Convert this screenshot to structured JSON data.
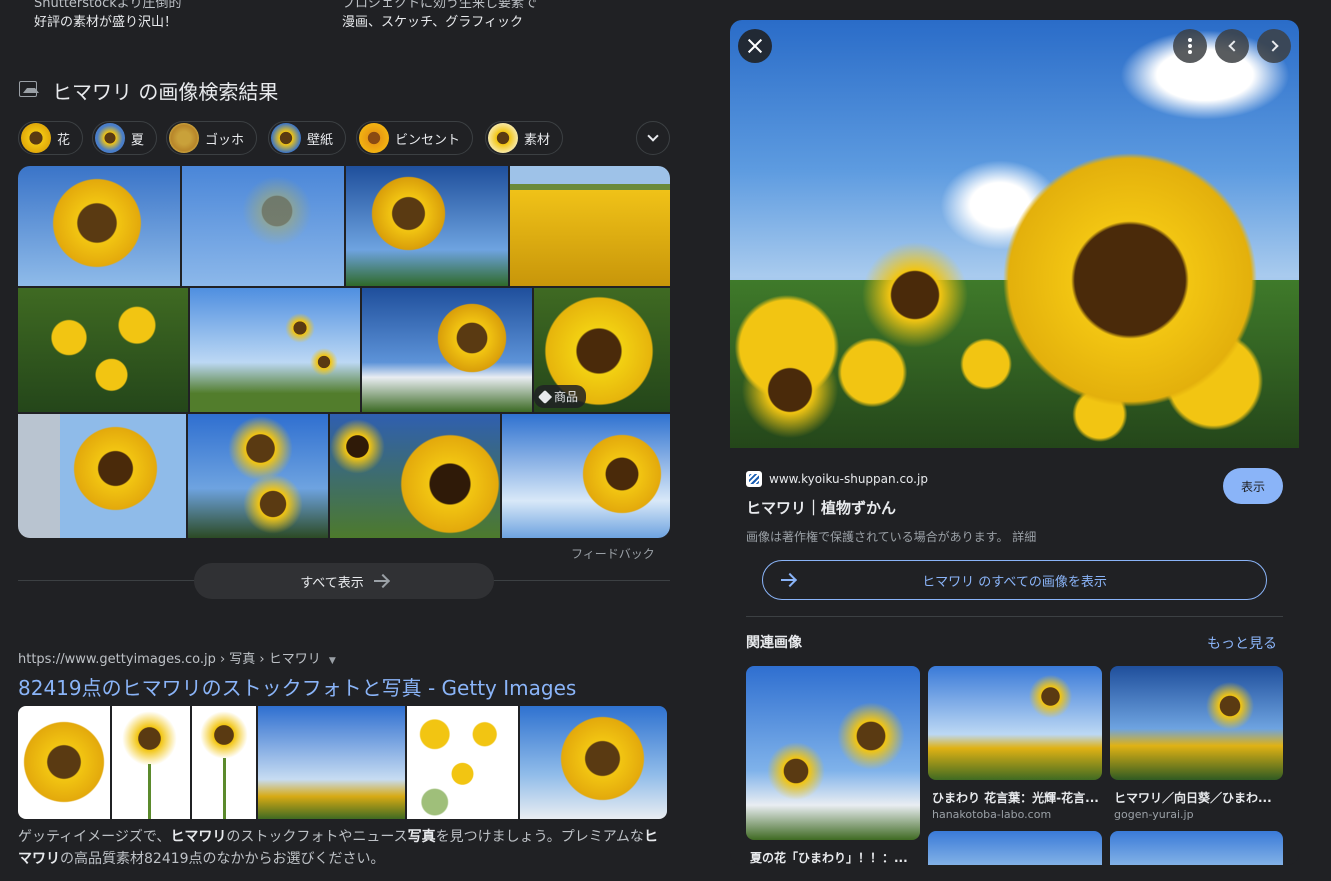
{
  "top_snippets": {
    "left_cut": "Shutterstockより圧倒的",
    "left_line": "好評の素材が盛り沢山！",
    "right_cut": "プロジェクトに効う生来し要素で",
    "right_line": "漫画、スケッチ、グラフィック"
  },
  "images_section": {
    "title": "ヒマワリ の画像検索結果",
    "chips": [
      "花",
      "夏",
      "ゴッホ",
      "壁紙",
      "ビンセント",
      "素材"
    ],
    "product_badge": "商品",
    "feedback": "フィードバック",
    "show_all": "すべて表示"
  },
  "result": {
    "breadcrumb": "https://www.gettyimages.co.jp › 写真 › ヒマワリ",
    "title": "82419点のヒマワリのストックフォトと写真 - Getty Images",
    "snippet_1": "ゲッティイメージズで、",
    "snippet_b1": "ヒマワリ",
    "snippet_2": "のストックフォトやニュース",
    "snippet_b2": "写真",
    "snippet_3": "を見つけましょう。プレミアムな",
    "snippet_b3": "ヒ",
    "snippet_b4": "マワリ",
    "snippet_4": "の高品質素材82419点のなかからお選びください。"
  },
  "panel": {
    "domain": "www.kyoiku-shuppan.co.jp",
    "title": "ヒマワリ｜植物ずかん",
    "view_button": "表示",
    "copyright": "画像は著作権で保護されている場合があります。 詳細",
    "all_images": "ヒマワリ のすべての画像を表示",
    "related_title": "関連画像",
    "more": "もっと見る",
    "related": [
      {
        "caption": "夏の花「ひまわり」！！：...",
        "domain": ""
      },
      {
        "caption": "ひまわり 花言葉：光輝-花言...",
        "domain": "hanakotoba-labo.com"
      },
      {
        "caption": "ヒマワリ／向日葵／ひまわ...",
        "domain": "gogen-yurai.jp"
      }
    ]
  },
  "colors": {
    "background": "#202124",
    "link": "#8ab4f8",
    "petal": "#f2c512",
    "center": "#5a3a12"
  }
}
